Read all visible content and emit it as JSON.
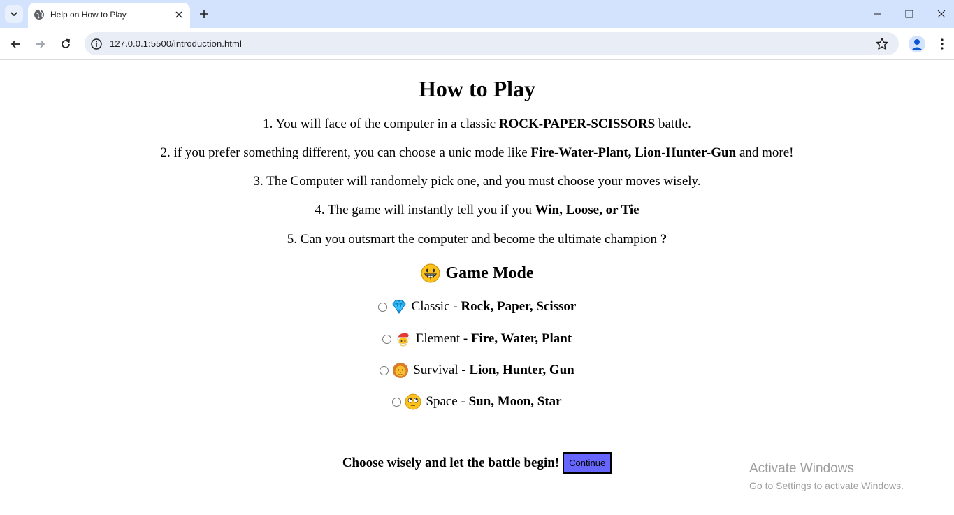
{
  "browser": {
    "tab_title": "Help on How to Play",
    "url": "127.0.0.1:5500/introduction.html"
  },
  "page": {
    "title": "How to Play",
    "rules": [
      {
        "prefix": "1. You will face of the computer in a classic ",
        "bold": "ROCK-PAPER-SCISSORS",
        "suffix": " battle."
      },
      {
        "prefix": "2. if you prefer something different, you can choose a unic mode like ",
        "bold": "Fire-Water-Plant, Lion-Hunter-Gun",
        "suffix": " and more!"
      },
      {
        "prefix": "3. The Computer will randomely pick one, and you must choose your moves wisely.",
        "bold": "",
        "suffix": ""
      },
      {
        "prefix": "4. The game will instantly tell you if you ",
        "bold": "Win, Loose, or Tie",
        "suffix": ""
      },
      {
        "prefix": "5. Can you outsmart the computer and become the ultimate champion ",
        "bold": "?",
        "suffix": ""
      }
    ],
    "game_mode_title": "Game Mode",
    "game_mode_icon": "grinning-face-icon",
    "modes": [
      {
        "name": "Classic",
        "sep": " - ",
        "items": "Rock, Paper, Scissor",
        "icon": "gem-icon"
      },
      {
        "name": "Element",
        "sep": " - ",
        "items": "Fire, Water, Plant",
        "icon": "santa-face-icon"
      },
      {
        "name": "Survival",
        "sep": " - ",
        "items": "Lion, Hunter, Gun",
        "icon": "lion-face-icon"
      },
      {
        "name": "Space",
        "sep": " - ",
        "items": "Sun, Moon, Star",
        "icon": "eye-roll-face-icon"
      }
    ],
    "footer_text": "Choose wisely and let the battle begin!",
    "continue_label": "Continue"
  },
  "watermark": {
    "line1": "Activate Windows",
    "line2": "Go to Settings to activate Windows."
  },
  "colors": {
    "tabstrip": "#d3e3fd",
    "omnibox": "#e9eef6",
    "continue_button": "#6666ff"
  }
}
